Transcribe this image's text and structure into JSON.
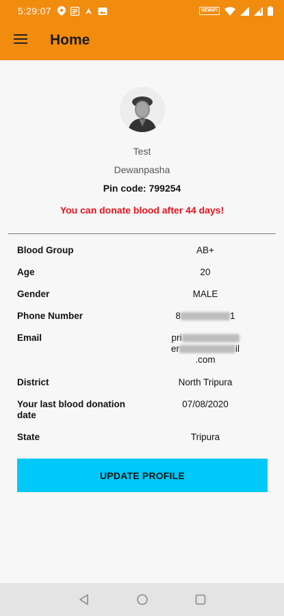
{
  "status_bar": {
    "time": "5:29:07",
    "wifi_badge": "NEWiFi"
  },
  "app_bar": {
    "title": "Home"
  },
  "profile": {
    "name": "Test",
    "city": "Dewanpasha",
    "pincode": "Pin code: 799254",
    "donation_message": "You can donate blood after 44 days!"
  },
  "details": {
    "blood_group_label": "Blood Group",
    "blood_group_value": "AB+",
    "age_label": "Age",
    "age_value": "20",
    "gender_label": "Gender",
    "gender_value": "MALE",
    "phone_label": "Phone Number",
    "phone_prefix": "8",
    "phone_suffix": "1",
    "email_label": "Email",
    "email_line1": "pri",
    "email_line2_start": "er",
    "email_line2_end": "il",
    "email_line3": ".com",
    "district_label": "District",
    "district_value": "North Tripura",
    "last_donation_label": "Your last blood donation date",
    "last_donation_value": "07/08/2020",
    "state_label": "State",
    "state_value": "Tripura"
  },
  "actions": {
    "update_label": "UPDATE PROFILE"
  },
  "colors": {
    "app_bar": "#f28c0f",
    "button": "#00c8f8",
    "alert": "#e0141c"
  },
  "icons": [
    "menu-icon",
    "location-icon",
    "settings-icon",
    "wifi-icon",
    "signal-icon",
    "battery-icon",
    "back-icon",
    "home-icon",
    "recents-icon"
  ]
}
